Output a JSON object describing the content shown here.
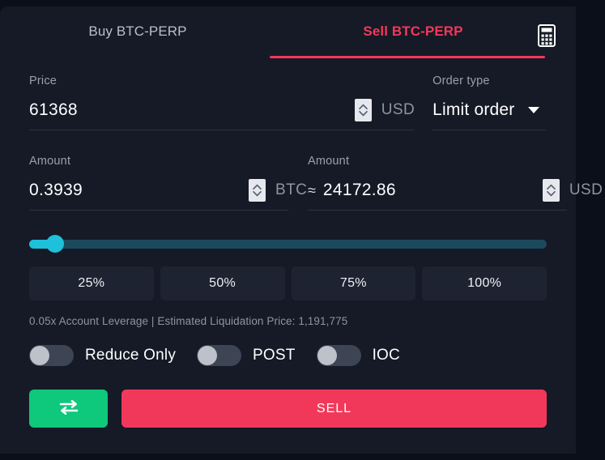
{
  "tabs": {
    "buy_label": "Buy BTC-PERP",
    "sell_label": "Sell BTC-PERP",
    "active": "sell",
    "calculator_icon": "calculator-icon"
  },
  "colors": {
    "accent_sell": "#f2385a",
    "accent_buy": "#0ec87b",
    "slider_fill": "#1ec0da",
    "slider_track": "#1c4a5c",
    "card_bg": "#151a26",
    "page_bg": "#0b0f19"
  },
  "price": {
    "label": "Price",
    "value": "61368",
    "placeholder": "0",
    "unit": "USD",
    "stepper_icon": "stepper-up-down-icon"
  },
  "order_type": {
    "label": "Order type",
    "value": "Limit order",
    "caret_icon": "chevron-down-icon",
    "options": [
      "Limit order"
    ]
  },
  "amount_base": {
    "label": "Amount",
    "value": "0.3939",
    "placeholder": "0",
    "unit": "BTC",
    "stepper_icon": "stepper-up-down-icon"
  },
  "amount_quote": {
    "label": "Amount",
    "approx_symbol": "≈",
    "value": "24172.86",
    "placeholder": "0",
    "unit": "USD",
    "stepper_icon": "stepper-up-down-icon"
  },
  "slider": {
    "percent": 5,
    "min": 0,
    "max": 100
  },
  "percent_buttons": [
    {
      "label": "25%"
    },
    {
      "label": "50%"
    },
    {
      "label": "75%"
    },
    {
      "label": "100%"
    }
  ],
  "info": {
    "text": "0.05x Account Leverage | Estimated Liquidation Price: 1,191,775",
    "leverage": "0.05x",
    "liquidation_price": "1,191,775"
  },
  "toggles": [
    {
      "label": "Reduce Only",
      "on": false
    },
    {
      "label": "POST",
      "on": false
    },
    {
      "label": "IOC",
      "on": false
    }
  ],
  "actions": {
    "swap_icon": "swap-arrows-icon",
    "swap_label": "",
    "submit_label": "SELL"
  }
}
